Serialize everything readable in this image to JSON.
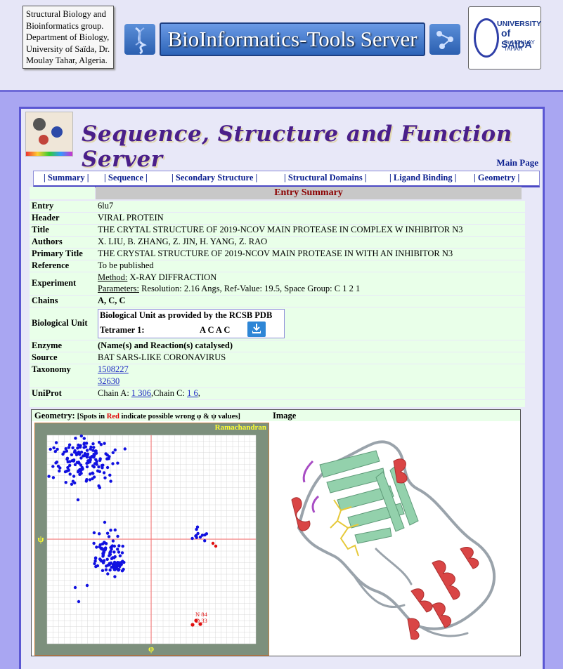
{
  "header": {
    "lab_lines": [
      "Structural Biology and",
      "Bioinformatics group.",
      "Department of Biology,",
      "University of Saïda, Dr.",
      "Moulay Tahar, Algeria."
    ],
    "server_title": "BioInformatics-Tools Server",
    "university": {
      "line1": "UNIVERSITY",
      "line2": "of SAIDA",
      "line3": "Dr MOULAY TAHAR"
    }
  },
  "page": {
    "title": "Sequence, Structure and Function Server",
    "main_page_link": "Main Page"
  },
  "tabs": [
    "Summary",
    "Sequence",
    "Secondary Structure",
    "Structural Domains",
    "Ligand Binding",
    "Geometry"
  ],
  "entry": {
    "section_title": "Entry Summary",
    "rows": [
      {
        "key": "Entry",
        "value": "6lu7"
      },
      {
        "key": "Header",
        "value": "VIRAL PROTEIN"
      },
      {
        "key": "Title",
        "value": "THE CRYTAL STRUCTURE OF 2019-NCOV MAIN PROTEASE IN COMPLEX W INHIBITOR N3"
      },
      {
        "key": "Authors",
        "value": "X. LIU, B. ZHANG, Z. JIN, H. YANG, Z. RAO"
      },
      {
        "key": "Primary Title",
        "value": "THE CRYSTAL STRUCTURE OF 2019-NCOV MAIN PROTEASE IN WITH AN INHIBITOR N3"
      },
      {
        "key": "Reference",
        "value": "To be published"
      }
    ],
    "experiment": {
      "key": "Experiment",
      "method_label": "Method:",
      "method": "X-RAY DIFFRACTION",
      "params_label": "Parameters:",
      "params": "Resolution: 2.16 Angs, Ref-Value: 19.5, Space Group: C 1 2 1"
    },
    "chains": {
      "key": "Chains",
      "value": "A, C, C"
    },
    "bio_unit": {
      "key": "Biological Unit",
      "box_title": "Biological Unit as provided by the RCSB PDB",
      "tetramer_label": "Tetramer 1:",
      "tetramer_chains": "A C A C"
    },
    "enzyme": {
      "key": "Enzyme",
      "value": "(Name(s) and Reaction(s) catalysed)"
    },
    "source": {
      "key": "Source",
      "value": "BAT SARS-LIKE CORONAVIRUS"
    },
    "taxonomy": {
      "key": "Taxonomy",
      "ids": [
        "1508227",
        "32630"
      ]
    },
    "uniprot": {
      "key": "UniProt",
      "prefix_a": "Chain A: ",
      "link_a": "1 306",
      "mid": ",Chain C: ",
      "link_c": "1 6",
      "suffix": ","
    }
  },
  "geometry": {
    "label": "Geometry:",
    "note_pre": "[Spots in ",
    "note_red": "Red",
    "note_post": " indicate possible wrong φ & ψ values]",
    "image_label": "Image",
    "plot_title": "Ramachandran",
    "phi": "φ",
    "psi": "ψ",
    "outlier_labels": [
      "N 84",
      "D 33"
    ],
    "colors": {
      "normal": "#1010e0",
      "outlier": "#e01010",
      "frame": "#7d907d",
      "title": "#ffff30"
    }
  }
}
